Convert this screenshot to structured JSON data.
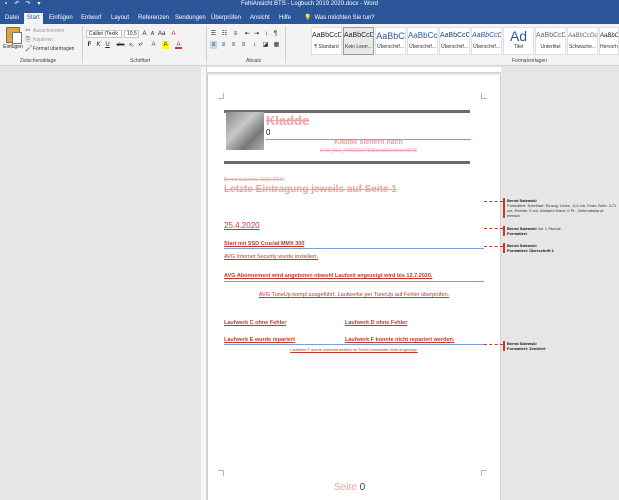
{
  "titlebar": {
    "title": "FehlAnsicht BTS - Logbuch 2019 2020.docx  -  Word",
    "qat_icons": [
      "save-icon",
      "undo-icon",
      "redo-icon",
      "customize-icon"
    ]
  },
  "tabs": [
    "Datei",
    "Start",
    "Einfügen",
    "Entwurf",
    "Layout",
    "Referenzen",
    "Sendungen",
    "Überprüfen",
    "Ansicht",
    "Hilfe"
  ],
  "active_tab": "Start",
  "search": {
    "placeholder": "Was möchten Sie tun?"
  },
  "clipboard": {
    "paste": "Einfügen",
    "cut": "Ausschneiden",
    "copy": "Kopieren",
    "format_painter": "Format übertragen",
    "group_label": "Zwischenablage"
  },
  "font": {
    "name": "Calibri (Textk",
    "size": "10,5",
    "group_label": "Schriftart",
    "buttons": [
      "F",
      "K",
      "U",
      "abc",
      "x₂",
      "x²",
      "A",
      "A",
      "A"
    ]
  },
  "paragraph": {
    "group_label": "Absatz"
  },
  "styles": {
    "group_label": "Formatvorlagen",
    "items": [
      {
        "sample": "AaBbCcDd",
        "name": "¶ Standard"
      },
      {
        "sample": "AaBbCcDd",
        "name": "Kein Leerr..."
      },
      {
        "sample": "AaBbC",
        "name": "Überschrif..."
      },
      {
        "sample": "AaBbCc",
        "name": "Überschrif..."
      },
      {
        "sample": "AaBbCcC",
        "name": "Überschrif..."
      },
      {
        "sample": "AaBbCcD",
        "name": "Überschrif..."
      },
      {
        "sample": "Ad",
        "name": "Titel"
      },
      {
        "sample": "AaBbCcD",
        "name": "Untertitel"
      },
      {
        "sample": "AaBbCcDd",
        "name": "Schwache..."
      },
      {
        "sample": "AaBbCcDd",
        "name": "Hervorhe..."
      }
    ]
  },
  "document": {
    "header_title": "Kladde",
    "header_number": "0",
    "subheader": "Kladde siehern nach",
    "path": "K:\\D_ALL_PROJEKTS\\Bernd\\Rechner\\BTS",
    "deleted_line": "Bernd Salewski 2019-2020",
    "heading": "Letzte Eintragung jeweils auf Seite 1",
    "date": "25.4.2020",
    "line1": "Start mit SSD Crucial MMX 300",
    "line2": "AVG Internet Security wurde installiert.",
    "line3": "AVG Abonnement wird angeboten obwohl Laufzeit angezeigt wird bis 12.7.2020.",
    "line4": "AVG TuneUp kompl ausgeführt. Laufwerke per TuneUp auf Fehler überprüfen.",
    "lw_c": "Laufwerk C ohne Fehler",
    "lw_d": "Laufwerk D ohne Fehler",
    "lw_e": "Laufwerk E wurde repariert",
    "lw_f": "Laufwerk F konnte nicht repariert werden.",
    "lw_note": "Laufwerk F wurde zwischenzeitlich im TotalCommander nicht angezeigt.",
    "footer_label": "Seite",
    "footer_number": "0"
  },
  "comments": [
    {
      "author": "Bernd Salewski",
      "text": "Formatiert: Schriftart: Einzug: Links: -0,6 cm, Erste Zeile: 3,71 cm, Rechts: 0 cm, Abstand Nach: 0 Pt., Zeilenabstand: einfach"
    },
    {
      "author": "Bernd Salewski",
      "text": "Vor 1 Stunde",
      "extra": "Formatiert"
    },
    {
      "author": "Bernd Salewski",
      "text": "Formatiert: Überschrift 1"
    },
    {
      "author": "Bernd Salewski",
      "text": "Formatiert: Zentriert"
    }
  ]
}
